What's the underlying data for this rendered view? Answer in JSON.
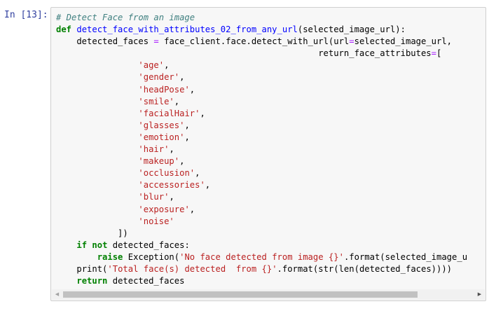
{
  "cell": {
    "prompt": "In [13]:",
    "code_lines": [
      {
        "parts": [
          {
            "t": "cm",
            "v": "# Detect Face from an image"
          }
        ]
      },
      {
        "parts": [
          {
            "t": "kw",
            "v": "def"
          },
          {
            "t": "",
            "v": " "
          },
          {
            "t": "fn",
            "v": "detect_face_with_attributes_02_from_any_url"
          },
          {
            "t": "",
            "v": "(selected_image_url):"
          }
        ]
      },
      {
        "parts": [
          {
            "t": "",
            "v": "    detected_faces "
          },
          {
            "t": "op",
            "v": "="
          },
          {
            "t": "",
            "v": " face_client.face.detect_with_url(url"
          },
          {
            "t": "op",
            "v": "="
          },
          {
            "t": "",
            "v": "selected_image_url,"
          }
        ]
      },
      {
        "parts": [
          {
            "t": "",
            "v": "                                                   return_face_attributes"
          },
          {
            "t": "op",
            "v": "="
          },
          {
            "t": "",
            "v": "["
          }
        ]
      },
      {
        "parts": [
          {
            "t": "",
            "v": "                "
          },
          {
            "t": "st",
            "v": "'age'"
          },
          {
            "t": "",
            "v": ","
          }
        ]
      },
      {
        "parts": [
          {
            "t": "",
            "v": "                "
          },
          {
            "t": "st",
            "v": "'gender'"
          },
          {
            "t": "",
            "v": ","
          }
        ]
      },
      {
        "parts": [
          {
            "t": "",
            "v": "                "
          },
          {
            "t": "st",
            "v": "'headPose'"
          },
          {
            "t": "",
            "v": ","
          }
        ]
      },
      {
        "parts": [
          {
            "t": "",
            "v": "                "
          },
          {
            "t": "st",
            "v": "'smile'"
          },
          {
            "t": "",
            "v": ","
          }
        ]
      },
      {
        "parts": [
          {
            "t": "",
            "v": "                "
          },
          {
            "t": "st",
            "v": "'facialHair'"
          },
          {
            "t": "",
            "v": ","
          }
        ]
      },
      {
        "parts": [
          {
            "t": "",
            "v": "                "
          },
          {
            "t": "st",
            "v": "'glasses'"
          },
          {
            "t": "",
            "v": ","
          }
        ]
      },
      {
        "parts": [
          {
            "t": "",
            "v": "                "
          },
          {
            "t": "st",
            "v": "'emotion'"
          },
          {
            "t": "",
            "v": ","
          }
        ]
      },
      {
        "parts": [
          {
            "t": "",
            "v": "                "
          },
          {
            "t": "st",
            "v": "'hair'"
          },
          {
            "t": "",
            "v": ","
          }
        ]
      },
      {
        "parts": [
          {
            "t": "",
            "v": "                "
          },
          {
            "t": "st",
            "v": "'makeup'"
          },
          {
            "t": "",
            "v": ","
          }
        ]
      },
      {
        "parts": [
          {
            "t": "",
            "v": "                "
          },
          {
            "t": "st",
            "v": "'occlusion'"
          },
          {
            "t": "",
            "v": ","
          }
        ]
      },
      {
        "parts": [
          {
            "t": "",
            "v": "                "
          },
          {
            "t": "st",
            "v": "'accessories'"
          },
          {
            "t": "",
            "v": ","
          }
        ]
      },
      {
        "parts": [
          {
            "t": "",
            "v": "                "
          },
          {
            "t": "st",
            "v": "'blur'"
          },
          {
            "t": "",
            "v": ","
          }
        ]
      },
      {
        "parts": [
          {
            "t": "",
            "v": "                "
          },
          {
            "t": "st",
            "v": "'exposure'"
          },
          {
            "t": "",
            "v": ","
          }
        ]
      },
      {
        "parts": [
          {
            "t": "",
            "v": "                "
          },
          {
            "t": "st",
            "v": "'noise'"
          }
        ]
      },
      {
        "parts": [
          {
            "t": "",
            "v": "            ])"
          }
        ]
      },
      {
        "parts": [
          {
            "t": "",
            "v": "    "
          },
          {
            "t": "kw",
            "v": "if"
          },
          {
            "t": "",
            "v": " "
          },
          {
            "t": "kw",
            "v": "not"
          },
          {
            "t": "",
            "v": " detected_faces:"
          }
        ]
      },
      {
        "parts": [
          {
            "t": "",
            "v": "        "
          },
          {
            "t": "kw",
            "v": "raise"
          },
          {
            "t": "",
            "v": " "
          },
          {
            "t": "",
            "v": "Exception"
          },
          {
            "t": "",
            "v": "("
          },
          {
            "t": "st",
            "v": "'No face detected from image {}'"
          },
          {
            "t": "",
            "v": ".format(selected_image_u"
          }
        ]
      },
      {
        "parts": [
          {
            "t": "",
            "v": "    "
          },
          {
            "t": "",
            "v": "print"
          },
          {
            "t": "",
            "v": "("
          },
          {
            "t": "st",
            "v": "'Total face(s) detected  from {}'"
          },
          {
            "t": "",
            "v": ".format("
          },
          {
            "t": "",
            "v": "str"
          },
          {
            "t": "",
            "v": "("
          },
          {
            "t": "",
            "v": "len"
          },
          {
            "t": "",
            "v": "(detected_faces))))"
          }
        ]
      },
      {
        "parts": [
          {
            "t": "",
            "v": "    "
          },
          {
            "t": "kw",
            "v": "return"
          },
          {
            "t": "",
            "v": " detected_faces"
          }
        ]
      }
    ]
  },
  "scrollbar": {
    "left_arrow": "◀",
    "right_arrow": "▶",
    "position_fraction": 0.0
  },
  "colors": {
    "keyword": "#008000",
    "comment": "#408080",
    "string": "#ba2121",
    "function": "#0000ff",
    "operator": "#aa22ff",
    "prompt": "#303f9f"
  },
  "icons": {
    "left_arrow": "scroll-left-icon",
    "right_arrow": "scroll-right-icon"
  }
}
